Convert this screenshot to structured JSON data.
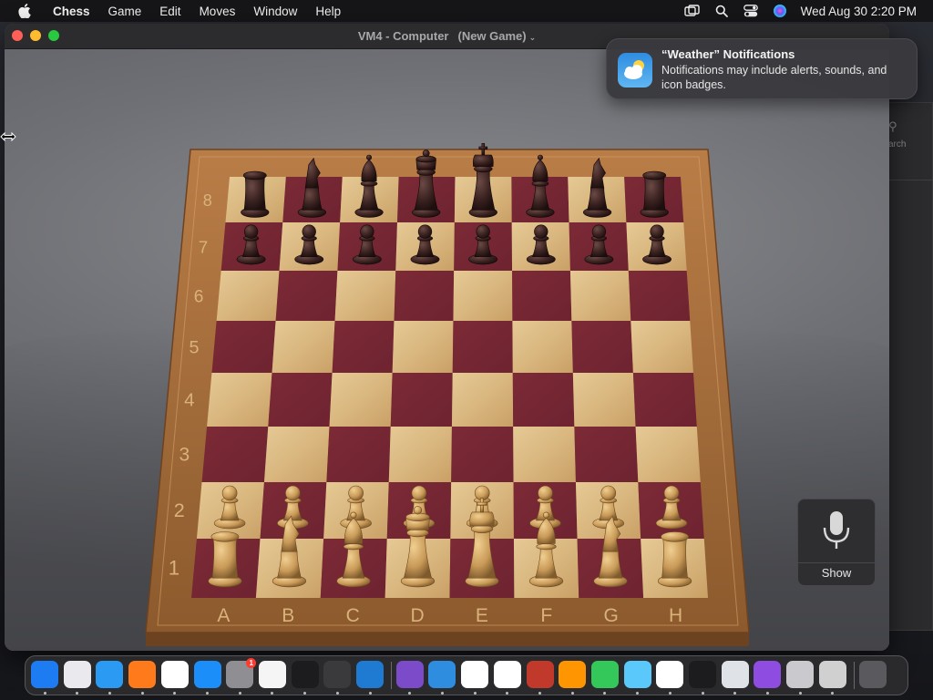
{
  "menubar": {
    "app_name": "Chess",
    "items": [
      "Game",
      "Edit",
      "Moves",
      "Window",
      "Help"
    ],
    "clock": "Wed Aug 30  2:20 PM",
    "status_icons": [
      "screen-mirroring-icon",
      "search-icon",
      "control-center-icon",
      "siri-icon"
    ]
  },
  "window": {
    "title": "VM4 - Computer",
    "subtitle": "(New Game)"
  },
  "board": {
    "files": [
      "A",
      "B",
      "C",
      "D",
      "E",
      "F",
      "G",
      "H"
    ],
    "ranks": [
      "8",
      "7",
      "6",
      "5",
      "4",
      "3",
      "2",
      "1"
    ],
    "light_square": "#d9b77f",
    "dark_square": "#6e2330",
    "frame_color": "#a0683a",
    "black_pieces": {
      "rank8": [
        "rook",
        "knight",
        "bishop",
        "queen",
        "king",
        "bishop",
        "knight",
        "rook"
      ],
      "rank7": [
        "pawn",
        "pawn",
        "pawn",
        "pawn",
        "pawn",
        "pawn",
        "pawn",
        "pawn"
      ]
    },
    "white_pieces": {
      "rank2": [
        "pawn",
        "pawn",
        "pawn",
        "pawn",
        "pawn",
        "pawn",
        "pawn",
        "pawn"
      ],
      "rank1": [
        "rook",
        "knight",
        "bishop",
        "queen",
        "king",
        "bishop",
        "knight",
        "rook"
      ]
    }
  },
  "notification": {
    "title": "“Weather” Notifications",
    "body": "Notifications may include alerts, sounds, and icon badges."
  },
  "dictation": {
    "label": "Show"
  },
  "background_window": {
    "search_label": "arch"
  },
  "dock": {
    "apps": [
      {
        "name": "Finder",
        "icon": "finder-icon",
        "color": "#1e7cf2"
      },
      {
        "name": "Launchpad",
        "icon": "launchpad-icon",
        "color": "#e9e9ee"
      },
      {
        "name": "Safari",
        "icon": "safari-icon",
        "color": "#2b9af3"
      },
      {
        "name": "Firefox",
        "icon": "firefox-icon",
        "color": "#ff7a1a"
      },
      {
        "name": "Chrome",
        "icon": "chrome-icon",
        "color": "#ffffff"
      },
      {
        "name": "App Store",
        "icon": "app-store-icon",
        "color": "#1c8ef9"
      },
      {
        "name": "System Settings",
        "icon": "settings-icon",
        "color": "#8e8e93",
        "badge": "1"
      },
      {
        "name": "TextEdit",
        "icon": "textedit-icon",
        "color": "#f5f5f5"
      },
      {
        "name": "Terminal",
        "icon": "terminal-icon",
        "color": "#1c1c1e"
      },
      {
        "name": "Instruments",
        "icon": "instruments-icon",
        "color": "#3a3a3c"
      },
      {
        "name": "VS Code",
        "icon": "vscode-icon",
        "color": "#1f7ad1"
      },
      {
        "name": "Visual Studio",
        "icon": "visual-studio-icon",
        "color": "#7b4bc9"
      },
      {
        "name": "Weather",
        "icon": "weather-icon",
        "color": "#2f8de0"
      },
      {
        "name": "Home",
        "icon": "home-icon",
        "color": "#ffffff"
      },
      {
        "name": "Freeform",
        "icon": "freeform-icon",
        "color": "#ffffff"
      },
      {
        "name": "Dictionary",
        "icon": "dictionary-icon",
        "color": "#c0392b"
      },
      {
        "name": "Books",
        "icon": "books-icon",
        "color": "#ff9500"
      },
      {
        "name": "FaceTime",
        "icon": "facetime-icon",
        "color": "#34c759"
      },
      {
        "name": "Maps",
        "icon": "maps-icon",
        "color": "#5ac8fa"
      },
      {
        "name": "News",
        "icon": "news-icon",
        "color": "#ffffff"
      },
      {
        "name": "Voice Memos",
        "icon": "voice-memos-icon",
        "color": "#1c1c1e"
      },
      {
        "name": "Preview",
        "icon": "preview-icon",
        "color": "#dfe3e8"
      },
      {
        "name": "Podcasts",
        "icon": "podcasts-icon",
        "color": "#8e4ce0"
      },
      {
        "name": "Screenshot",
        "icon": "screenshot-icon",
        "color": "#c9c9ce"
      },
      {
        "name": "Chess",
        "icon": "chess-icon",
        "color": "#d0d0d0"
      },
      {
        "name": "Trash",
        "icon": "trash-icon",
        "color": "#5a5a5e"
      }
    ]
  }
}
